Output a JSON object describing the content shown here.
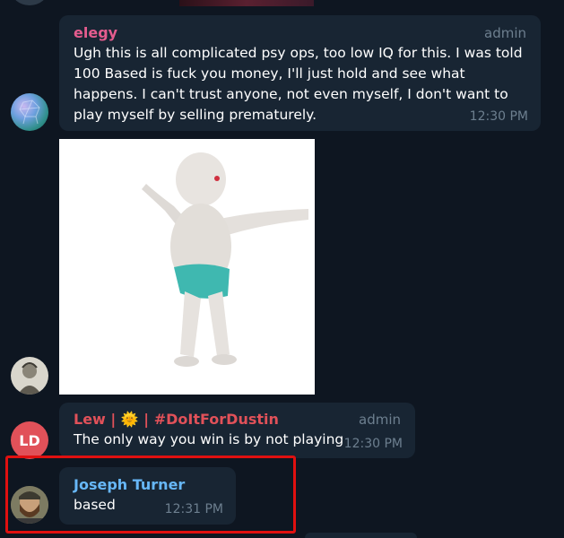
{
  "colors": {
    "background": "#0e1621",
    "bubble": "#182533",
    "name_elegy": "#e45c8e",
    "name_lew": "#e15159",
    "name_joseph": "#67b7f7",
    "meta_text": "#6d7f8f",
    "highlight": "#e01010"
  },
  "messages": [
    {
      "sender": "elegy",
      "role": "admin",
      "text": "Ugh this is all complicated psy ops, too low IQ for this. I was told 100 Based is fuck you money, I'll just hold and see what happens. I can't trust anyone, not even myself, I don't want to play myself by selling prematurely.",
      "time": "12:30 PM",
      "avatar_icon": "crystal-sphere-avatar"
    },
    {
      "type": "image",
      "image_icon": "dancing-baby-image",
      "avatar_icon": "sketch-portrait-avatar"
    },
    {
      "sender": "Lew | 🌞 | #DoItForDustin",
      "role": "admin",
      "text": "The only way you win is by not playing",
      "time": "12:30 PM",
      "avatar_initials": "LD"
    },
    {
      "sender": "Joseph Turner",
      "text": "based",
      "time": "12:31 PM",
      "avatar_icon": "photo-avatar"
    }
  ]
}
